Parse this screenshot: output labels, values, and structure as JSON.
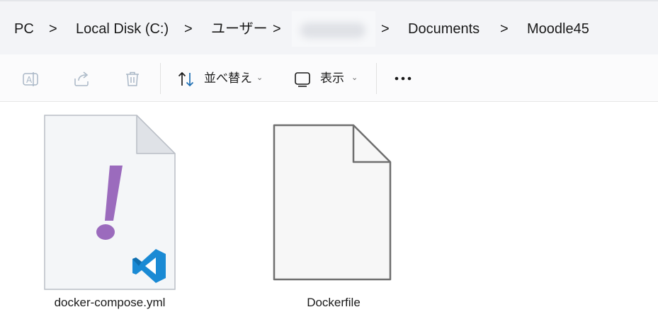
{
  "breadcrumb": {
    "items": [
      "PC",
      "Local Disk (C:)",
      "ユーザー",
      "",
      "Documents",
      "Moodle45"
    ],
    "separator": ">"
  },
  "toolbar": {
    "rename_icon": "rename-icon",
    "share_icon": "share-icon",
    "delete_icon": "trash-icon",
    "sort_label": "並べ替え",
    "view_label": "表示",
    "more_icon": "more-options-icon"
  },
  "files": [
    {
      "name": "docker-compose.yml",
      "icon": "yaml-vscode-file-icon"
    },
    {
      "name": "Dockerfile",
      "icon": "generic-file-icon"
    }
  ],
  "colors": {
    "yaml_mark": "#9b6bbd",
    "vscode_blue": "#1a8ad4",
    "sort_arrow": "#1f6fb3"
  }
}
